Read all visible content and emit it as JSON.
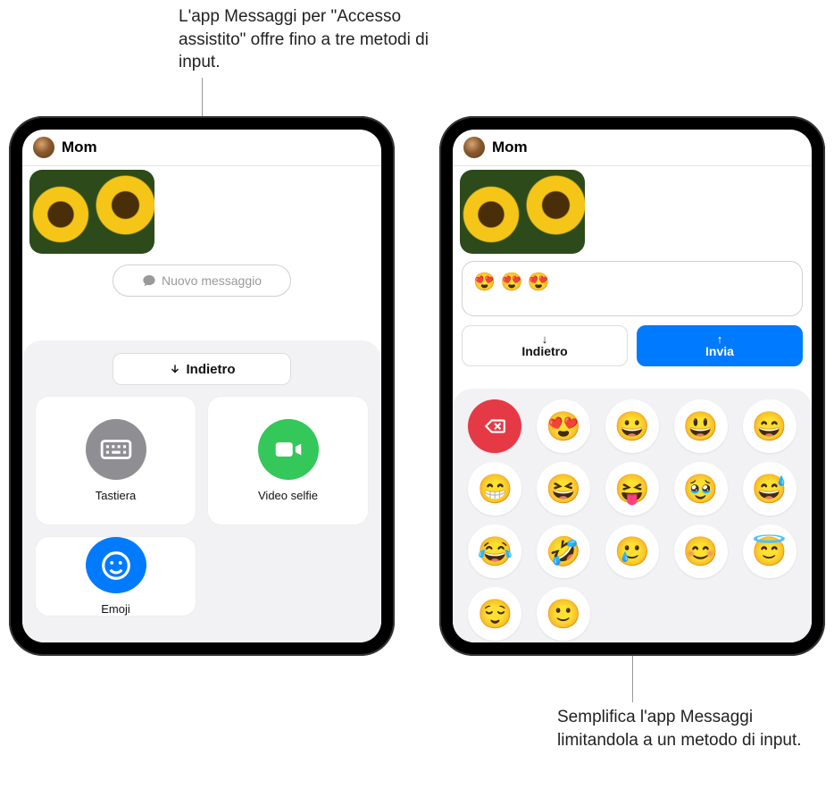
{
  "callouts": {
    "top": "L'app Messaggi per \"Accesso assistito\" offre fino a tre metodi di input.",
    "bottom": "Semplifica l'app Messaggi limitandola a un metodo di input."
  },
  "left": {
    "contact_name": "Mom",
    "compose_placeholder": "Nuovo messaggio",
    "back_label": "Indietro",
    "options": {
      "keyboard": "Tastiera",
      "video_selfie": "Video selfie",
      "emoji": "Emoji"
    }
  },
  "right": {
    "contact_name": "Mom",
    "compose_content": "😍 😍 😍",
    "back_label": "Indietro",
    "send_label": "Invia",
    "emoji_keys": [
      "⌫",
      "😍",
      "😀",
      "😃",
      "😄",
      "😁",
      "😆",
      "😝",
      "🥹",
      "",
      "😅",
      "😂",
      "🤣",
      "🥲",
      "",
      "😊",
      "😇",
      "😌",
      "🙂",
      ""
    ]
  }
}
